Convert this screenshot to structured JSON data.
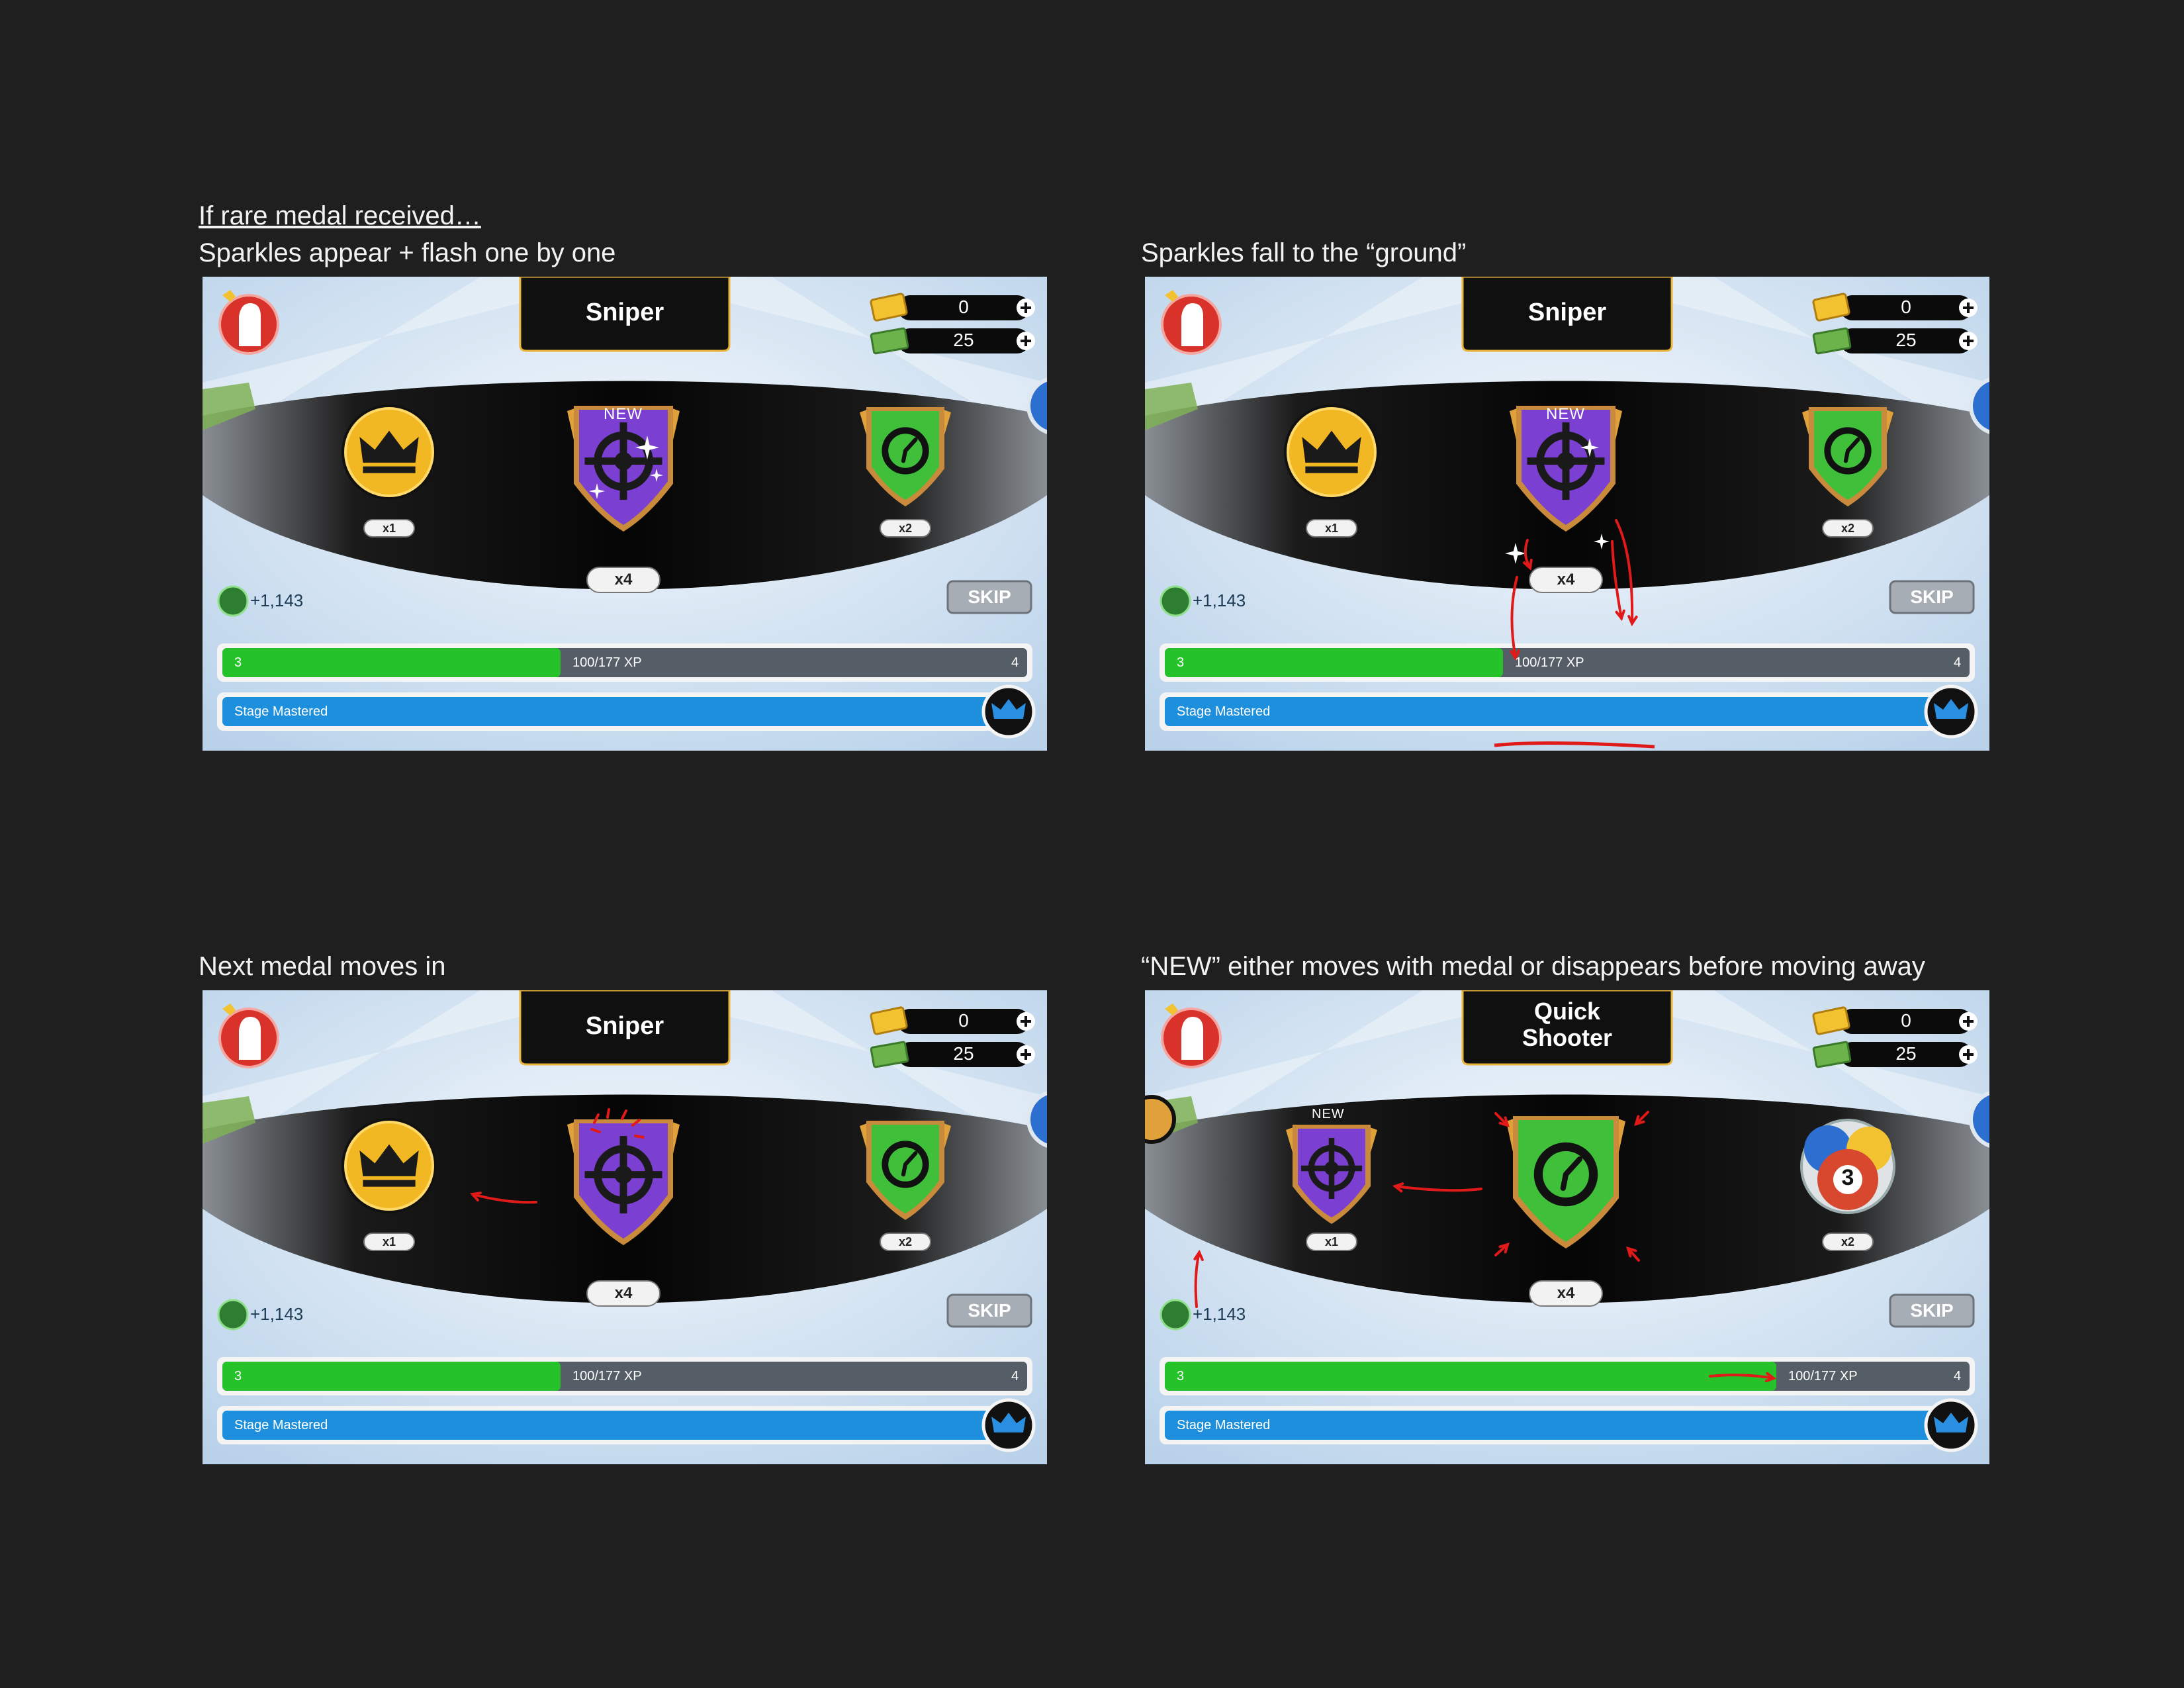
{
  "captions": {
    "p1": {
      "heading": "If rare medal received…",
      "text": "Sparkles appear + flash one by one"
    },
    "p2": {
      "text": "Sparkles fall to the “ground”"
    },
    "p3": {
      "text": "Next medal moves in"
    },
    "p4": {
      "text": "“NEW” either moves with medal or disappears before moving away"
    }
  },
  "panels": [
    {
      "title": "Sniper",
      "gold": "0",
      "cash": "25",
      "new_label": "NEW",
      "left_count": "x1",
      "center_count": "x4",
      "right_count": "x2",
      "xp_gain": "+1,143",
      "level_from": "3",
      "xp_progress": "100/177 XP",
      "level_to": "4",
      "stage_label": "Stage Mastered",
      "skip_label": "SKIP",
      "xp_fill_fraction": 0.42
    },
    {
      "title": "Sniper",
      "gold": "0",
      "cash": "25",
      "new_label": "NEW",
      "left_count": "x1",
      "center_count": "x4",
      "right_count": "x2",
      "xp_gain": "+1,143",
      "level_from": "3",
      "xp_progress": "100/177 XP",
      "level_to": "4",
      "stage_label": "Stage Mastered",
      "skip_label": "SKIP",
      "xp_fill_fraction": 0.42
    },
    {
      "title": "Sniper",
      "gold": "0",
      "cash": "25",
      "left_count": "x1",
      "center_count": "x4",
      "right_count": "x2",
      "xp_gain": "+1,143",
      "level_from": "3",
      "xp_progress": "100/177 XP",
      "level_to": "4",
      "stage_label": "Stage Mastered",
      "skip_label": "SKIP",
      "xp_fill_fraction": 0.42
    },
    {
      "title": "Quick Shooter",
      "title_line1": "Quick",
      "title_line2": "Shooter",
      "gold": "0",
      "cash": "25",
      "new_label": "NEW",
      "left_count": "x1",
      "center_count": "x4",
      "right_count": "x2",
      "ball_number": "3",
      "xp_gain": "+1,143",
      "level_from": "3",
      "xp_progress": "100/177 XP",
      "level_to": "4",
      "stage_label": "Stage Mastered",
      "skip_label": "SKIP",
      "xp_fill_fraction": 0.76
    }
  ],
  "colors": {
    "page_bg": "#1f1f1f",
    "sky": "#d7e6f4",
    "band": "#0b0b0b",
    "title_bg": "#101010",
    "gold_rim": "#f2c231",
    "purple": "#7b3fd1",
    "green": "#3fbf3a",
    "xp_green": "#26c22a",
    "xp_track": "#555e66",
    "stage_blue": "#1e8fdc",
    "annotation_red": "#e01919"
  },
  "icons": [
    "avatar-icon",
    "crown-medal-icon",
    "crosshair-shield-icon",
    "clock-shield-icon",
    "gold-bar-icon",
    "cash-icon",
    "plus-icon",
    "xp-icon",
    "crown-badge-icon",
    "pool-balls-icon"
  ]
}
